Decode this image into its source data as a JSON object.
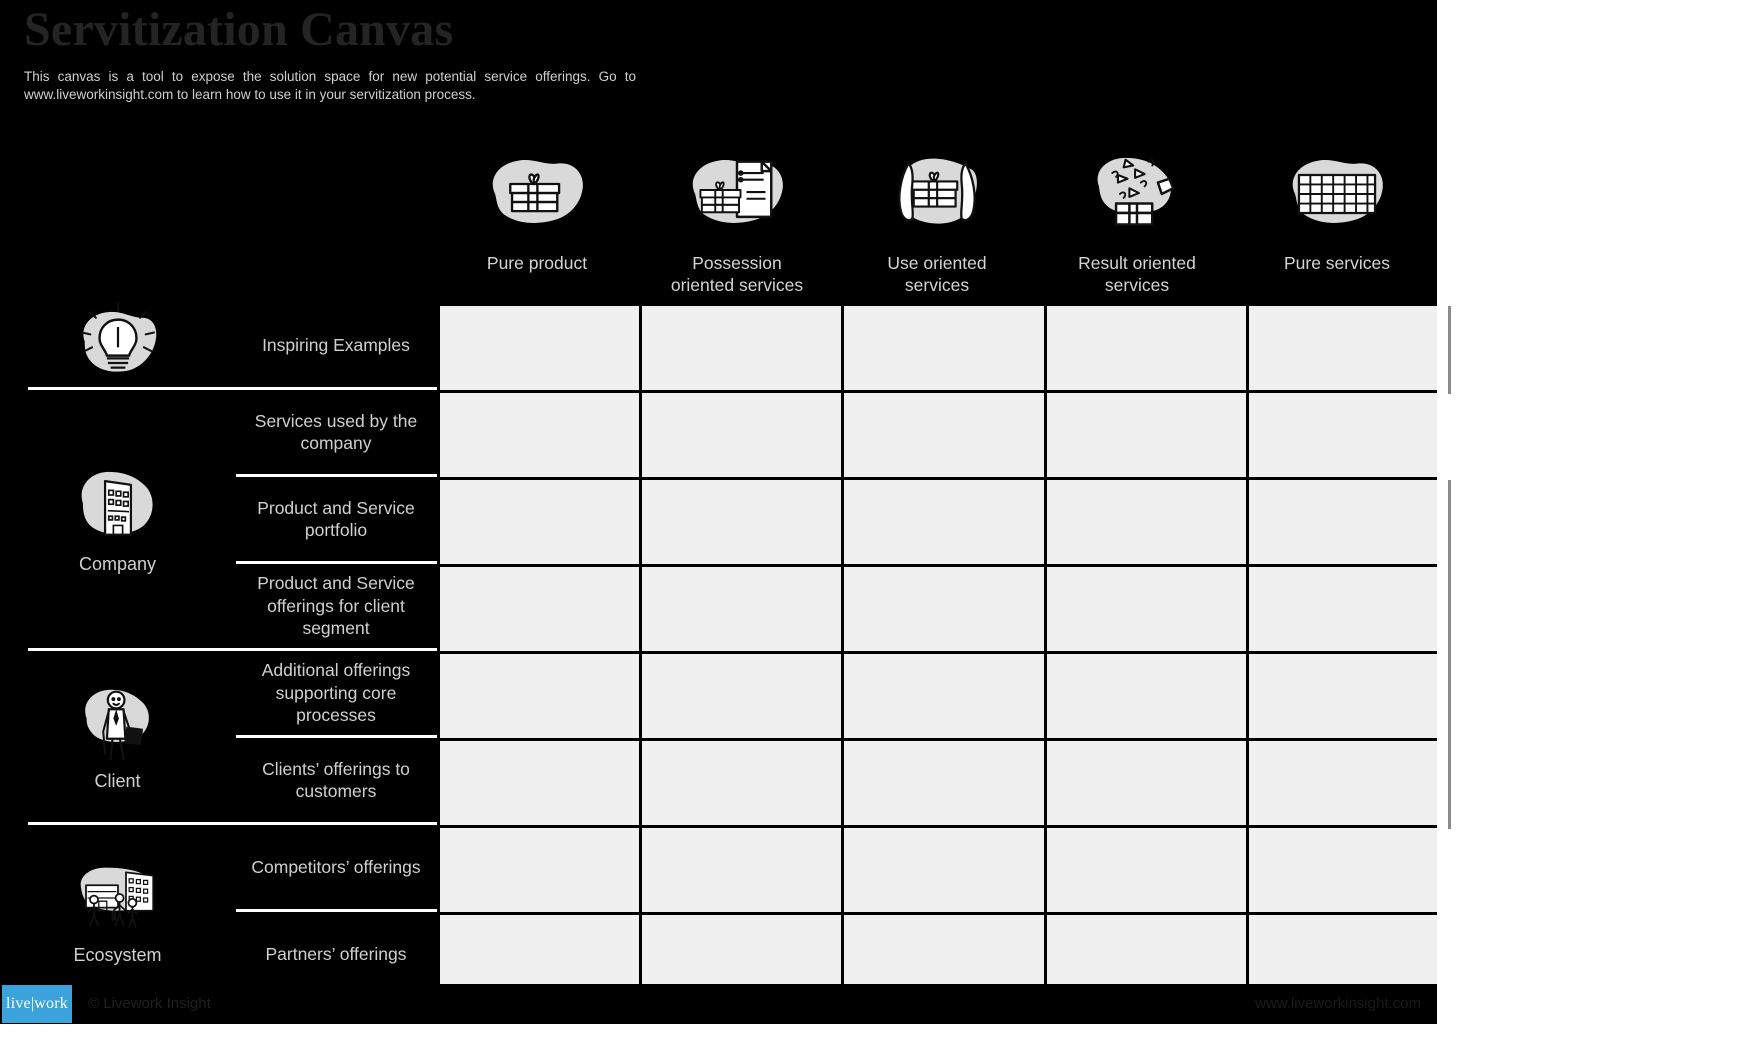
{
  "canvas": {
    "title": "Servitization Canvas",
    "intro": "This canvas is a tool to expose the solution space for new potential service offerings. Go to www.liveworkinsight.com to learn how to use it in your servitization process.",
    "background_color": "#000000",
    "cell_color": "#f0f0f0",
    "accent_color": "#3aa3db",
    "text_color": "#d0d0d0"
  },
  "columns": [
    {
      "label": "Pure product",
      "icon": "gift-box-icon"
    },
    {
      "label": "Possession oriented services",
      "icon": "gift-box-with-document-icon"
    },
    {
      "label": "Use oriented services",
      "icon": "hands-holding-gift-icon"
    },
    {
      "label": "Result oriented services",
      "icon": "gift-box-with-sparkles-icon"
    },
    {
      "label": "Pure services",
      "icon": "grid-services-icon"
    }
  ],
  "groups": [
    {
      "name": "",
      "icon": "lightbulb-icon",
      "rows": [
        {
          "label": "Inspiring Examples"
        }
      ]
    },
    {
      "name": "Company",
      "icon": "office-building-icon",
      "rows": [
        {
          "label": "Services used by the company"
        },
        {
          "label": "Product and Service portfolio"
        },
        {
          "label": "Product and Service offerings for client segment"
        }
      ]
    },
    {
      "name": "Client",
      "icon": "businessperson-icon",
      "rows": [
        {
          "label": "Additional  offerings supporting core processes"
        },
        {
          "label": "Clients’ offerings to customers"
        }
      ]
    },
    {
      "name": "Ecosystem",
      "icon": "city-people-icon",
      "rows": [
        {
          "label": "Competitors’ offerings"
        },
        {
          "label": "Partners’ offerings"
        }
      ]
    }
  ],
  "footer": {
    "logo": "live|work",
    "copyright": "© Livework Insight",
    "url": "www.liveworkinsight.com"
  }
}
